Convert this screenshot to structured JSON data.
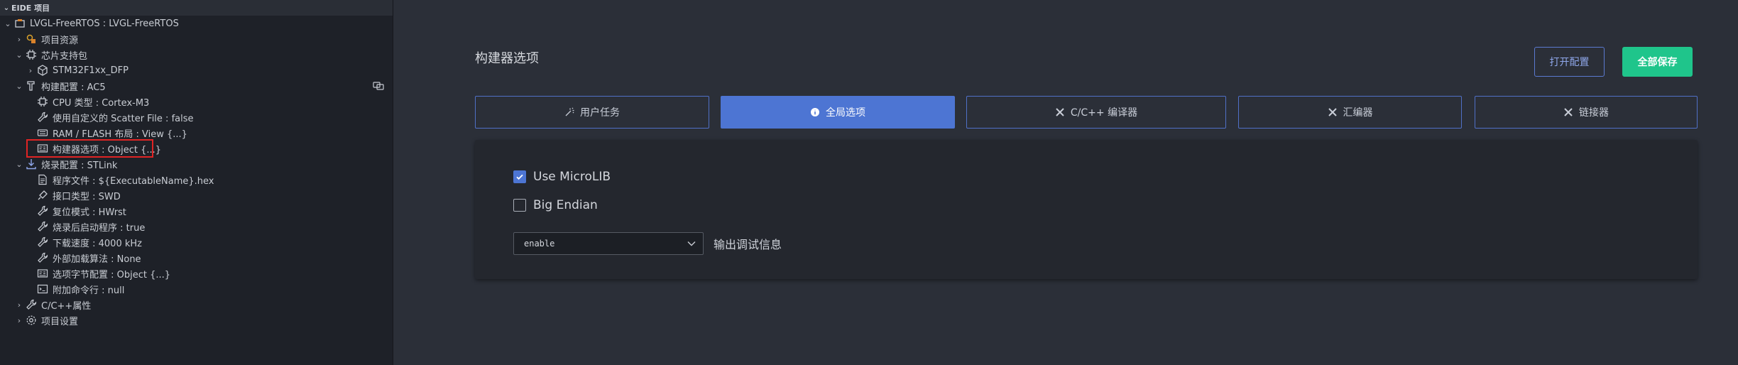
{
  "sidebar": {
    "header": "EIDE 项目",
    "project": "LVGL-FreeRTOS : LVGL-FreeRTOS",
    "items": [
      {
        "label": "项目资源"
      },
      {
        "label": "芯片支持包"
      },
      {
        "label": "STM32F1xx_DFP"
      },
      {
        "label": "构建配置 : AC5"
      },
      {
        "label": "CPU 类型 : Cortex-M3"
      },
      {
        "label": "使用自定义的 Scatter File : false"
      },
      {
        "label": "RAM / FLASH 布局 : View {...}"
      },
      {
        "label": "构建器选项 : Object {...}"
      },
      {
        "label": "烧录配置 : STLink"
      },
      {
        "label": "程序文件 : ${ExecutableName}.hex"
      },
      {
        "label": "接口类型 : SWD"
      },
      {
        "label": "复位模式 : HWrst"
      },
      {
        "label": "烧录后启动程序 : true"
      },
      {
        "label": "下载速度 : 4000 kHz"
      },
      {
        "label": "外部加载算法 : None"
      },
      {
        "label": "选项字节配置 : Object {...}"
      },
      {
        "label": "附加命令行 : null"
      },
      {
        "label": "C/C++属性"
      },
      {
        "label": "项目设置"
      }
    ]
  },
  "main": {
    "title": "构建器选项",
    "open_config_label": "打开配置",
    "save_all_label": "全部保存",
    "tabs": [
      {
        "label": "用户任务"
      },
      {
        "label": "全局选项"
      },
      {
        "label": "C/C++ 编译器"
      },
      {
        "label": "汇编器"
      },
      {
        "label": "链接器"
      }
    ],
    "options": {
      "use_microlib_label": "Use MicroLIB",
      "use_microlib_checked": true,
      "big_endian_label": "Big Endian",
      "big_endian_checked": false,
      "debug_info_value": "enable",
      "debug_info_label": "输出调试信息"
    }
  },
  "colors": {
    "accent": "#4d75d3",
    "save": "#1fc58b",
    "highlight": "#e02424"
  }
}
